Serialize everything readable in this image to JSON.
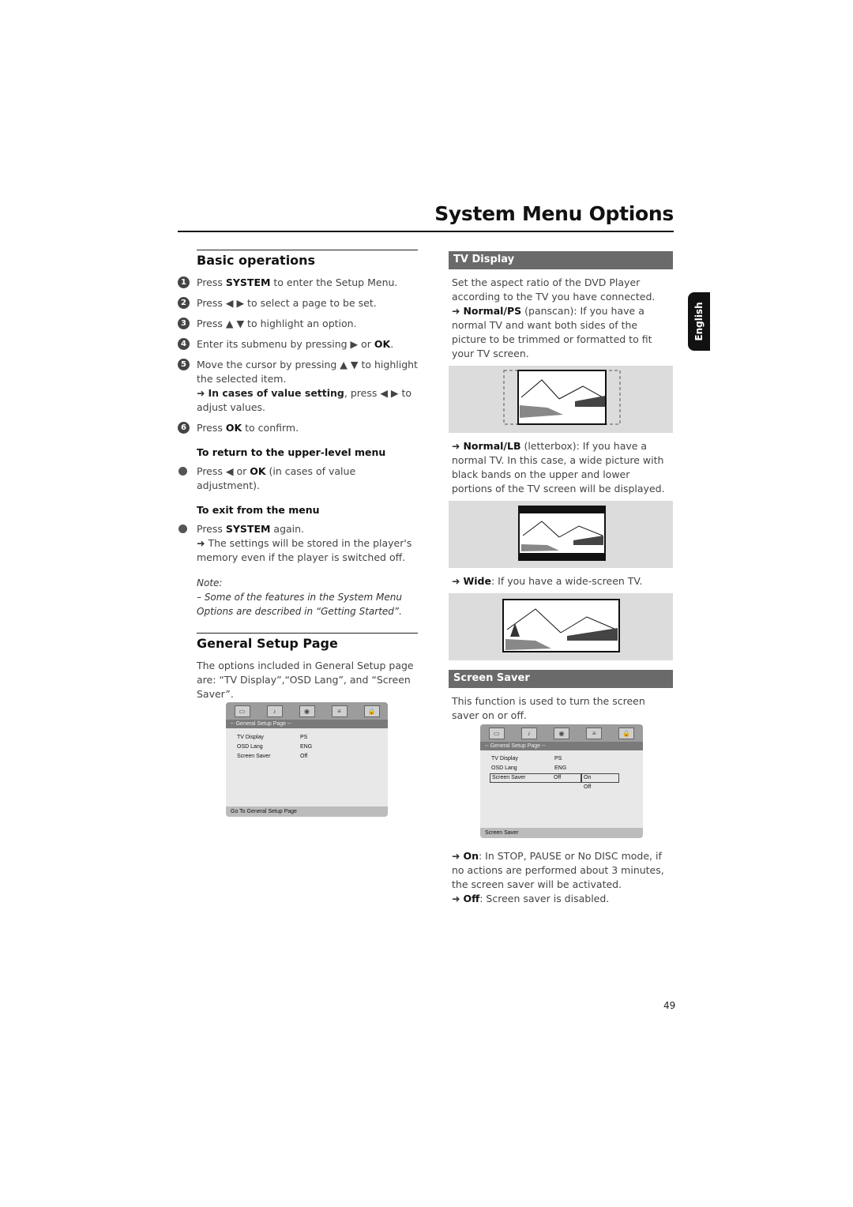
{
  "page": {
    "title": "System Menu Options",
    "language_tab": "English",
    "page_number": "49"
  },
  "basic_operations": {
    "heading": "Basic operations",
    "steps": [
      {
        "num": "1",
        "pre": "Press ",
        "bold": "SYSTEM",
        "post": " to enter the Setup Menu."
      },
      {
        "num": "2",
        "pre": "Press ◀ ▶  to select a page to be set.",
        "bold": "",
        "post": ""
      },
      {
        "num": "3",
        "pre": "Press ▲ ▼  to highlight an option.",
        "bold": "",
        "post": ""
      },
      {
        "num": "4",
        "pre": "Enter its submenu by pressing ▶  or ",
        "bold": "OK",
        "post": "."
      },
      {
        "num": "5",
        "pre": "Move the cursor by pressing ▲ ▼  to highlight the selected item.",
        "bold": "",
        "post": ""
      },
      {
        "num": "6",
        "pre": "Press ",
        "bold": "OK",
        "post": " to confirm."
      }
    ],
    "step5_arrow": {
      "bold": "In cases of value setting",
      "post": ", press ◀ ▶  to adjust values."
    },
    "return_heading": "To return to the upper-level menu",
    "return_bullet": {
      "pre": "Press ◀  or ",
      "bold": "OK",
      "post": " (in cases of value adjustment)."
    },
    "exit_heading": "To exit from the menu",
    "exit_bullet": {
      "pre": "Press ",
      "bold": "SYSTEM",
      "post": " again."
    },
    "exit_arrow": "The settings will be stored in the player's memory even if the player is switched off.",
    "note_label": "Note:",
    "note_text": "–  Some of the features in the System Menu Options are described in “Getting Started”."
  },
  "general_setup": {
    "heading": "General Setup Page",
    "intro": "The options included in General Setup page are: “TV Display”,“OSD Lang”, and  “Screen Saver”.",
    "menu": {
      "icons": [
        "general-setup-icon",
        "audio-setup-icon",
        "video-setup-icon",
        "preference-icon",
        "password-lock-icon"
      ],
      "title": "-- General Setup Page --",
      "rows": [
        {
          "label": "TV Display",
          "value": "PS"
        },
        {
          "label": "OSD Lang",
          "value": "ENG"
        },
        {
          "label": "Screen Saver",
          "value": "Off"
        }
      ],
      "footer": "Go To General Setup Page"
    }
  },
  "tv_display": {
    "heading": "TV Display",
    "intro": "Set the aspect ratio of the DVD Player according to the TV you have connected.",
    "normal_ps": {
      "bold": "Normal/PS",
      "text": " (panscan): If you have a normal TV and want both sides of the picture to be trimmed or formatted to fit your TV screen."
    },
    "normal_lb": {
      "bold": "Normal/LB",
      "text": " (letterbox): If you have a normal TV. In this case, a wide picture with black bands on the upper and lower portions of the TV screen will be displayed."
    },
    "wide": {
      "bold": "Wide",
      "text": ": If you have a wide-screen TV."
    }
  },
  "screen_saver": {
    "heading": "Screen Saver",
    "intro": "This function is used to turn the screen saver on or off.",
    "menu": {
      "title": "-- General Setup Page --",
      "rows": [
        {
          "label": "TV Display",
          "value": "PS"
        },
        {
          "label": "OSD Lang",
          "value": "ENG"
        },
        {
          "label": "Screen Saver",
          "value": "Off"
        }
      ],
      "options": [
        "On",
        "Off"
      ],
      "selected_option": "On",
      "footer": "Screen Saver"
    },
    "on": {
      "bold": "On",
      "text": ": In STOP, PAUSE or No DISC mode, if no actions are performed about 3 minutes, the screen saver will be activated."
    },
    "off": {
      "bold": "Off",
      "text": ": Screen saver is disabled."
    }
  }
}
